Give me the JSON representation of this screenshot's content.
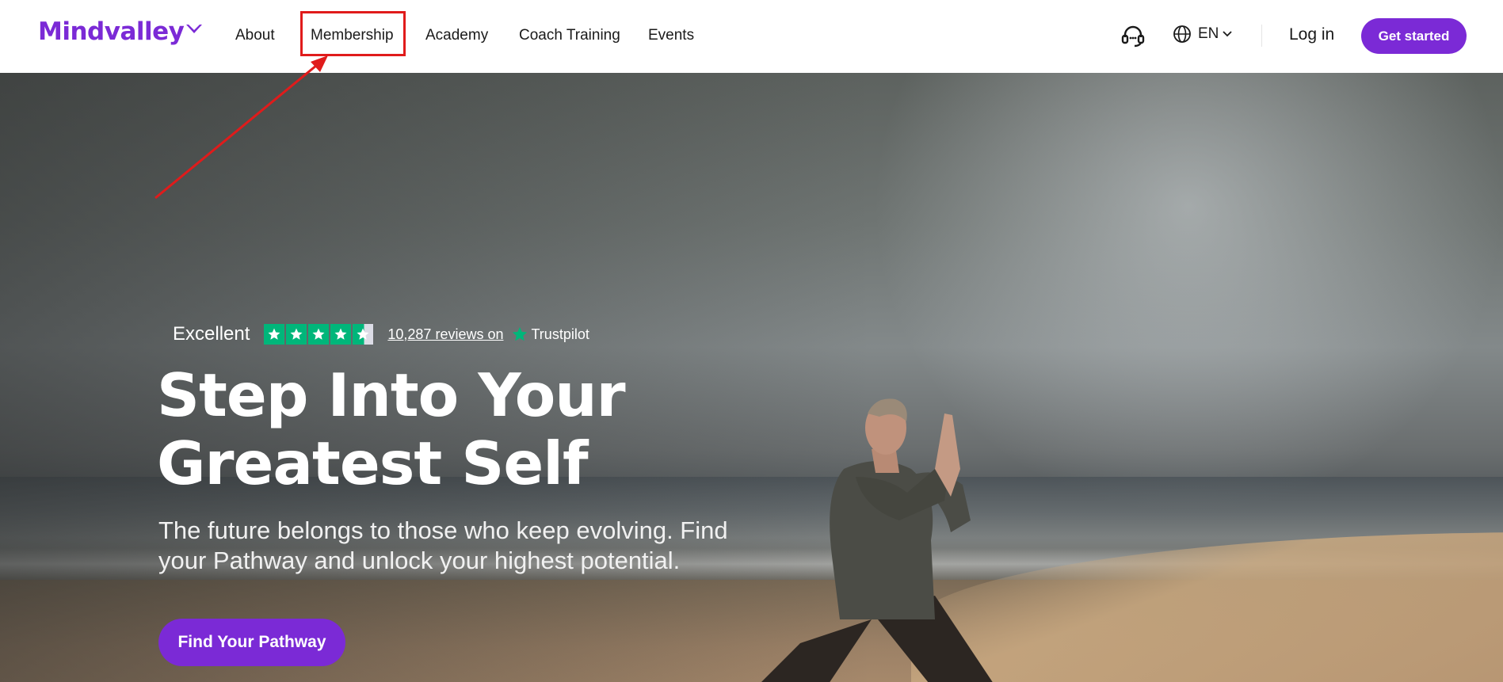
{
  "brand": {
    "name": "Mindvalley",
    "accent": "#7b2ad6"
  },
  "nav": {
    "items": [
      {
        "label": "About"
      },
      {
        "label": "Membership"
      },
      {
        "label": "Academy"
      },
      {
        "label": "Coach Training"
      },
      {
        "label": "Events"
      }
    ],
    "language": "EN",
    "login_label": "Log in",
    "get_started_label": "Get started"
  },
  "hero": {
    "rating_label": "Excellent",
    "stars": 4.5,
    "reviews_link": "10,287 reviews on",
    "trustpilot": "Trustpilot",
    "headline_line1": "Step Into Your",
    "headline_line2": "Greatest Self",
    "subhead": "The future belongs to those who keep evolving. Find your Pathway and unlock your highest potential.",
    "cta_label": "Find Your Pathway"
  },
  "annotation": {
    "highlight_color": "#e01b1b"
  }
}
